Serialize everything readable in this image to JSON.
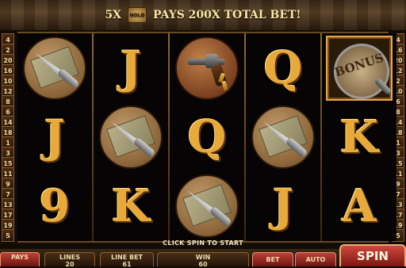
{
  "banner": {
    "multiplier": "5X",
    "badge_text": "HOLD",
    "pays_text": "PAYS 200X TOTAL BET!"
  },
  "paylines_left": [
    "4",
    "2",
    "20",
    "16",
    "10",
    "12",
    "8",
    "6",
    "14",
    "18",
    "1",
    "3",
    "15",
    "11",
    "9",
    "7",
    "13",
    "17",
    "19",
    "5"
  ],
  "paylines_right": [
    "4",
    "16",
    "20",
    "12",
    "2",
    "10",
    "6",
    "8",
    "14",
    "18",
    "1",
    "3",
    "15",
    "11",
    "9",
    "7",
    "13",
    "17",
    "19",
    "5"
  ],
  "reels": [
    [
      {
        "type": "knife"
      },
      {
        "type": "letter",
        "value": "J"
      },
      {
        "type": "letter",
        "value": "9"
      }
    ],
    [
      {
        "type": "letter",
        "value": "J"
      },
      {
        "type": "knife"
      },
      {
        "type": "letter",
        "value": "K"
      }
    ],
    [
      {
        "type": "gun"
      },
      {
        "type": "letter",
        "value": "Q"
      },
      {
        "type": "knife"
      }
    ],
    [
      {
        "type": "letter",
        "value": "Q"
      },
      {
        "type": "knife"
      },
      {
        "type": "letter",
        "value": "J"
      }
    ],
    [
      {
        "type": "bonus",
        "value": "BONUS"
      },
      {
        "type": "letter",
        "value": "K"
      },
      {
        "type": "letter",
        "value": "A"
      }
    ]
  ],
  "status": "CLICK SPIN TO START",
  "controls": {
    "paytable_label": "PAYS",
    "lines_label": "LINES",
    "lines_value": "20",
    "line_bet_label": "LINE BET",
    "line_bet_value": "61",
    "win_label": "WIN",
    "win_value": "60",
    "bet_label": "BET",
    "auto_label": "AUTO",
    "spin_label": "SPIN"
  }
}
